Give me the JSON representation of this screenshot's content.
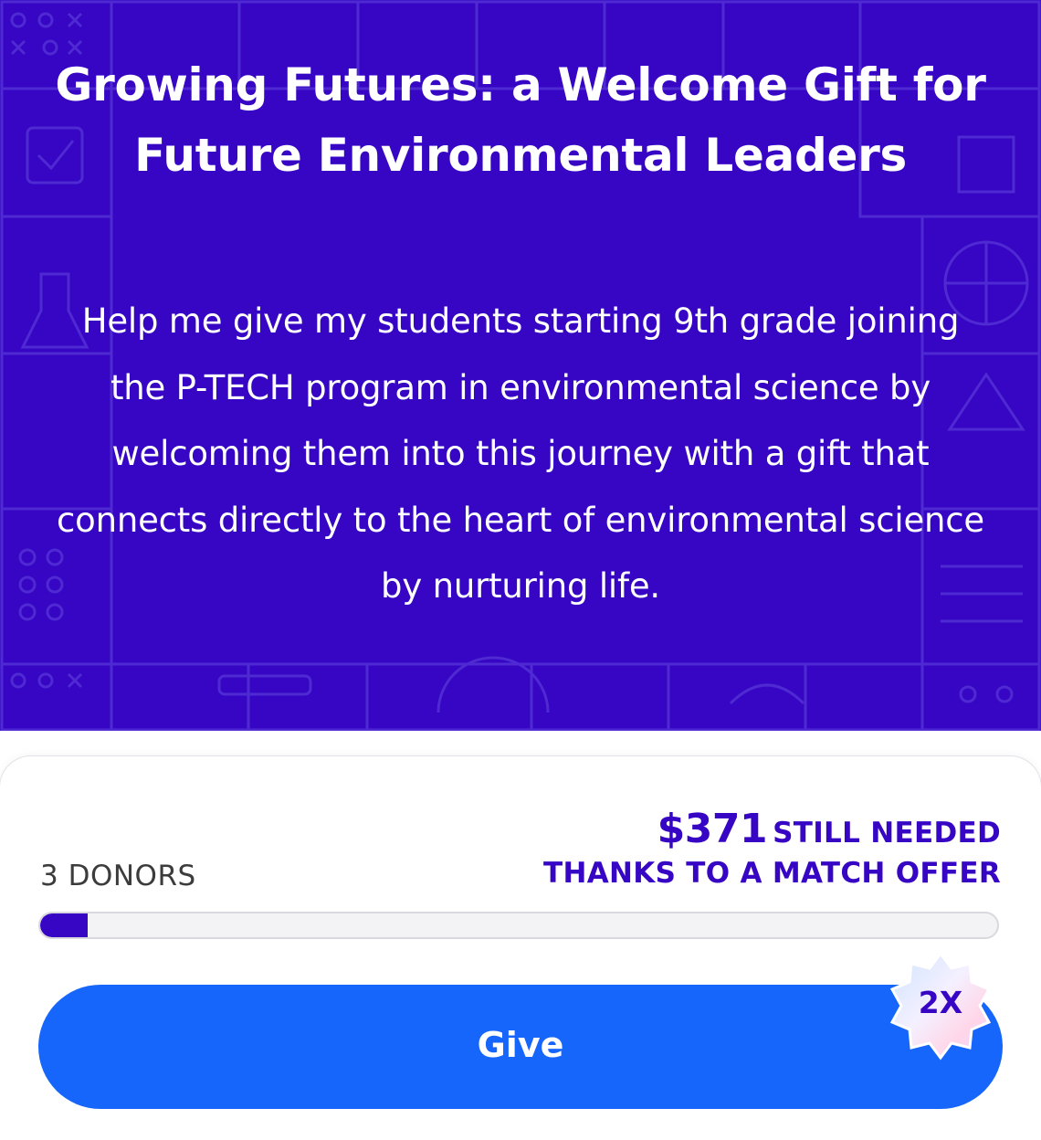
{
  "hero": {
    "title": "Growing Futures: a Welcome Gift for Future Environmental Leaders",
    "description": "Help me give my students starting 9th grade joining the P-TECH program in environmental science by welcoming them into this journey with a gift that connects directly to the heart of environmental science by nurturing life."
  },
  "funding": {
    "amount_needed": "$371",
    "needed_label": "STILL NEEDED",
    "match_note": "THANKS TO A MATCH OFFER",
    "donors": "3 DONORS",
    "progress_fraction": 0.05
  },
  "give_button": {
    "label": "Give"
  },
  "match_badge": {
    "label": "2X"
  },
  "colors": {
    "hero_background": "#3606c4",
    "accent": "#3606c4",
    "button": "#1766fb"
  }
}
